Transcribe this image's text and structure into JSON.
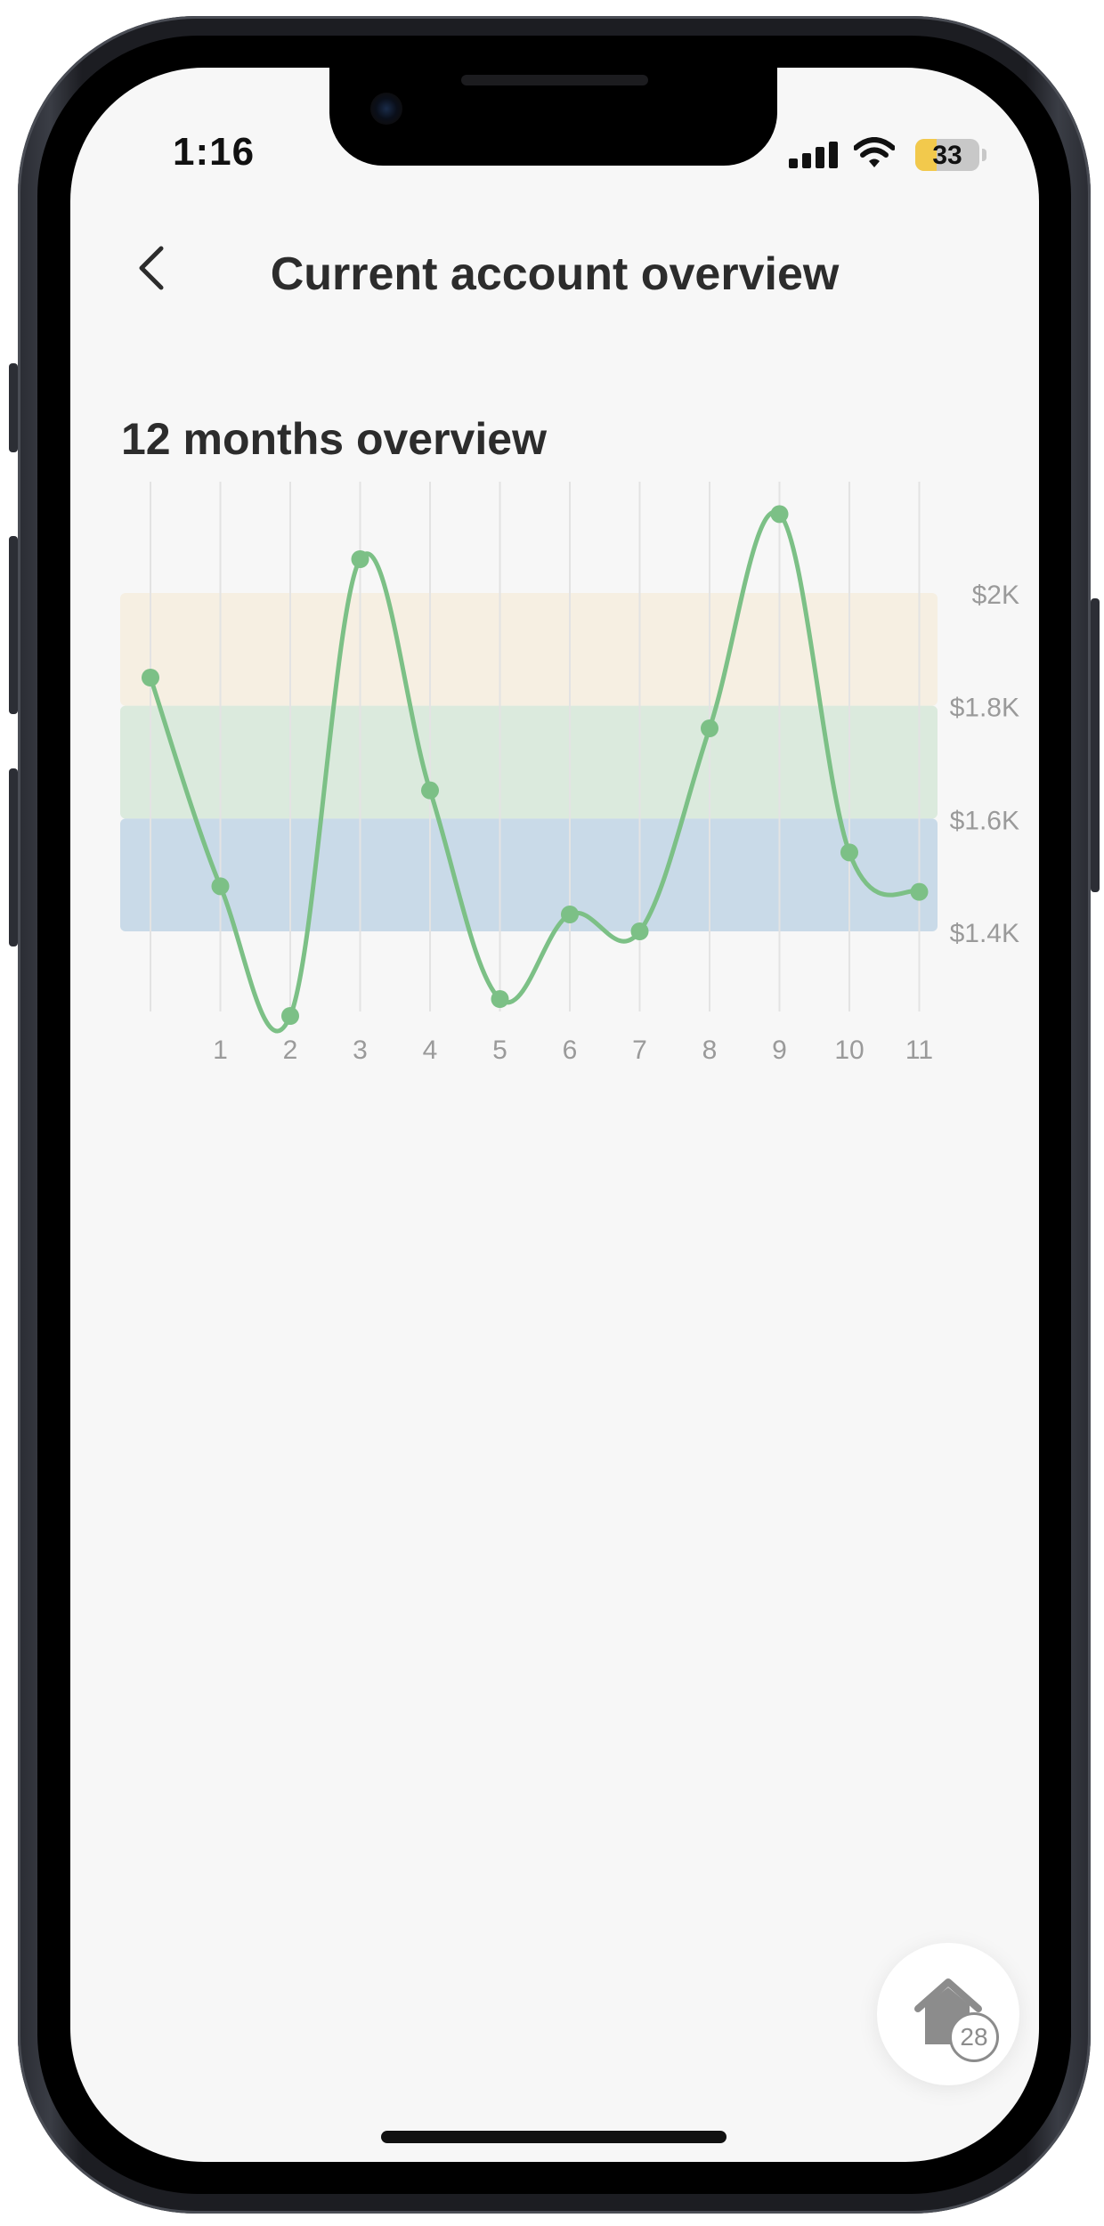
{
  "status_bar": {
    "time": "1:16",
    "battery_level": "33",
    "battery_fraction": 0.33
  },
  "header": {
    "title": "Current account overview",
    "back_icon": "chevron-left-icon"
  },
  "section": {
    "title": "12 months overview"
  },
  "chart_data": {
    "type": "line",
    "x": [
      0,
      1,
      2,
      3,
      4,
      5,
      6,
      7,
      8,
      9,
      10,
      11
    ],
    "x_tick_labels": [
      "1",
      "2",
      "3",
      "4",
      "5",
      "6",
      "7",
      "8",
      "9",
      "10",
      "11"
    ],
    "series": [
      {
        "values": [
          1850,
          1480,
          1250,
          2060,
          1650,
          1280,
          1430,
          1400,
          1760,
          2140,
          1540,
          1470
        ],
        "color": "#7cc086"
      }
    ],
    "y_tick_labels": [
      "$2K",
      "$1.8K",
      "$1.6K",
      "$1.4K"
    ],
    "y_ticks": [
      2000,
      1800,
      1600,
      1400
    ],
    "bands": [
      {
        "from": 1800,
        "to": 2000,
        "color": "#f6efe2"
      },
      {
        "from": 1600,
        "to": 1800,
        "color": "#dbeadd"
      },
      {
        "from": 1400,
        "to": 1600,
        "color": "#c9dae8"
      }
    ],
    "ylim": [
      1250,
      2140
    ],
    "grid_vertical": true,
    "legend": false
  },
  "fab": {
    "icon": "home-icon",
    "badge": "28"
  }
}
